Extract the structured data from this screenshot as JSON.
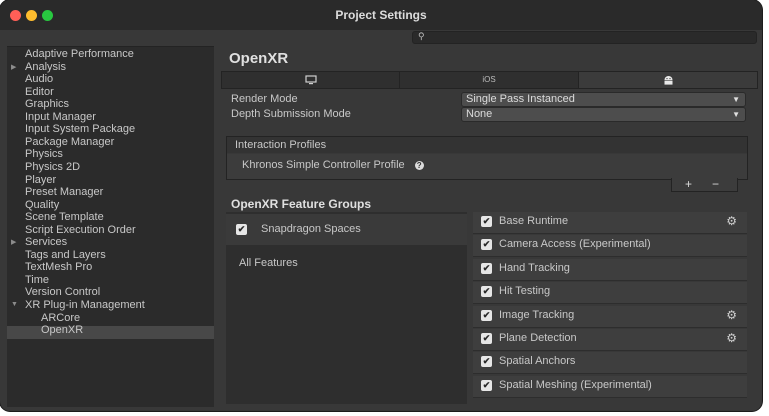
{
  "window": {
    "title": "Project Settings"
  },
  "search": {
    "placeholder": ""
  },
  "sidebar": {
    "items": [
      {
        "label": "Adaptive Performance",
        "arrow": false,
        "child": false
      },
      {
        "label": "Analysis",
        "arrow": true,
        "child": false
      },
      {
        "label": "Audio",
        "arrow": false,
        "child": false
      },
      {
        "label": "Editor",
        "arrow": false,
        "child": false
      },
      {
        "label": "Graphics",
        "arrow": false,
        "child": false
      },
      {
        "label": "Input Manager",
        "arrow": false,
        "child": false
      },
      {
        "label": "Input System Package",
        "arrow": false,
        "child": false
      },
      {
        "label": "Package Manager",
        "arrow": false,
        "child": false
      },
      {
        "label": "Physics",
        "arrow": false,
        "child": false
      },
      {
        "label": "Physics 2D",
        "arrow": false,
        "child": false
      },
      {
        "label": "Player",
        "arrow": false,
        "child": false
      },
      {
        "label": "Preset Manager",
        "arrow": false,
        "child": false
      },
      {
        "label": "Quality",
        "arrow": false,
        "child": false
      },
      {
        "label": "Scene Template",
        "arrow": false,
        "child": false
      },
      {
        "label": "Script Execution Order",
        "arrow": false,
        "child": false
      },
      {
        "label": "Services",
        "arrow": true,
        "child": false
      },
      {
        "label": "Tags and Layers",
        "arrow": false,
        "child": false
      },
      {
        "label": "TextMesh Pro",
        "arrow": false,
        "child": false
      },
      {
        "label": "Time",
        "arrow": false,
        "child": false
      },
      {
        "label": "Version Control",
        "arrow": false,
        "child": false
      },
      {
        "label": "XR Plug-in Management",
        "arrow": "open",
        "child": false
      },
      {
        "label": "ARCore",
        "arrow": false,
        "child": true
      },
      {
        "label": "OpenXR",
        "arrow": false,
        "child": true,
        "selected": true
      }
    ]
  },
  "main": {
    "heading": "OpenXR",
    "tabs": [
      {
        "label": "",
        "icon": "monitor-icon"
      },
      {
        "label": "iOS",
        "icon": ""
      },
      {
        "label": "",
        "icon": "android-icon",
        "active": true
      }
    ],
    "render_mode": {
      "label": "Render Mode",
      "value": "Single Pass Instanced"
    },
    "depth_mode": {
      "label": "Depth Submission Mode",
      "value": "None"
    },
    "profiles": {
      "header": "Interaction Profiles",
      "items": [
        "Khronos Simple Controller Profile"
      ],
      "add": "+",
      "remove": "−"
    },
    "feature_groups": {
      "title": "OpenXR Feature Groups",
      "groups": [
        {
          "label": "Snapdragon Spaces",
          "checked": true,
          "selected": true
        },
        {
          "label": "All Features",
          "checked": false,
          "selected": false
        }
      ],
      "features": [
        {
          "label": "Base Runtime",
          "checked": true,
          "gear": true
        },
        {
          "label": "Camera Access (Experimental)",
          "checked": true,
          "gear": false
        },
        {
          "label": "Hand Tracking",
          "checked": true,
          "gear": false
        },
        {
          "label": "Hit Testing",
          "checked": true,
          "gear": false
        },
        {
          "label": "Image Tracking",
          "checked": true,
          "gear": true
        },
        {
          "label": "Plane Detection",
          "checked": true,
          "gear": true
        },
        {
          "label": "Spatial Anchors",
          "checked": true,
          "gear": false
        },
        {
          "label": "Spatial Meshing (Experimental)",
          "checked": true,
          "gear": false
        }
      ]
    }
  }
}
